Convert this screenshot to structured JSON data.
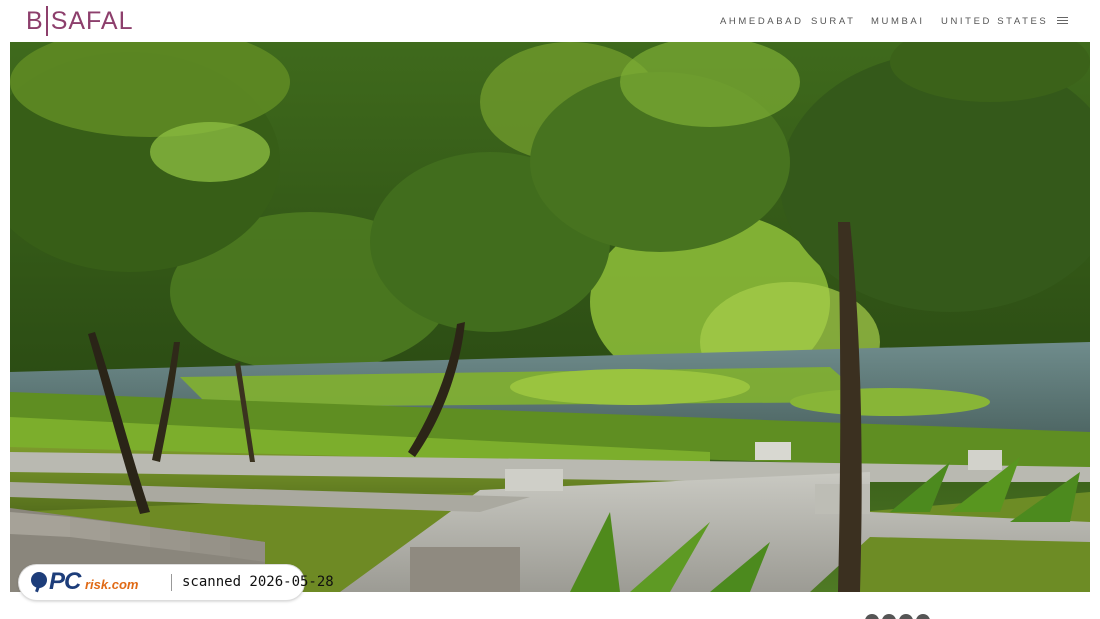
{
  "brand": {
    "logo_letter": "B",
    "logo_rest": "SAFAL",
    "logo_color": "#8d3f6c"
  },
  "nav": {
    "items": [
      {
        "label": "AHMEDABAD"
      },
      {
        "label": "SURAT"
      },
      {
        "label": "MUMBAI"
      },
      {
        "label": "UNITED STATES"
      }
    ],
    "menu_icon": "hamburger-menu-icon"
  },
  "hero": {
    "scene": "landscaped garden with trees, pond with lily pads, stone steps and lawn"
  },
  "watermark": {
    "logo_pc": "PC",
    "logo_risk": "risk.com",
    "text": "scanned 2026-05-28"
  },
  "pager": {
    "dot_count": 4
  }
}
